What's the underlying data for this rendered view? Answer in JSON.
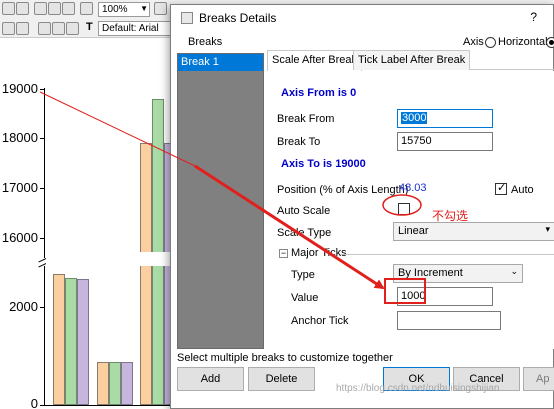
{
  "app": {
    "zoom": "100%",
    "font": "Default: Arial"
  },
  "chart": {
    "yticks_upper": [
      "19000",
      "18000",
      "17000",
      "16000"
    ],
    "yticks_lower": [
      "2000",
      "0"
    ],
    "colors": {
      "orange": "#fbcf9f",
      "green": "#a9dba6",
      "purple": "#c6b6de"
    }
  },
  "dialog": {
    "title": "Breaks Details",
    "help": "?",
    "breaks_header": "Breaks",
    "axis_label": "Axis",
    "horizontal_label": "Horizontal",
    "break_items": [
      "Break 1"
    ],
    "tabs": [
      "Scale After Break",
      "Tick Label After Break"
    ],
    "axis_from_heading": "Axis From is 0",
    "break_from_label": "Break From",
    "break_from_value": "3000",
    "break_to_label": "Break To",
    "break_to_value": "15750",
    "axis_to_heading": "Axis To is 19000",
    "position_label": "Position (% of Axis Length)",
    "position_value": "48.03",
    "auto_label": "Auto",
    "auto_checked": true,
    "auto_scale_label": "Auto Scale",
    "auto_scale_checked": false,
    "scale_type_label": "Scale Type",
    "scale_type_value": "Linear",
    "major_ticks_label": "Major Ticks",
    "type_label": "Type",
    "type_value": "By Increment",
    "value_label": "Value",
    "value_value": "1000",
    "anchor_tick_label": "Anchor Tick",
    "anchor_tick_value": "",
    "hint": "Select multiple breaks to customize together",
    "buttons": {
      "add": "Add",
      "delete": "Delete",
      "ok": "OK",
      "cancel": "Cancel",
      "apply": "Ap"
    }
  },
  "annotation": {
    "note": "不勾选",
    "color": "#e0201c"
  },
  "watermark": "https://blog.csdn.net/ndhuisingshijian"
}
